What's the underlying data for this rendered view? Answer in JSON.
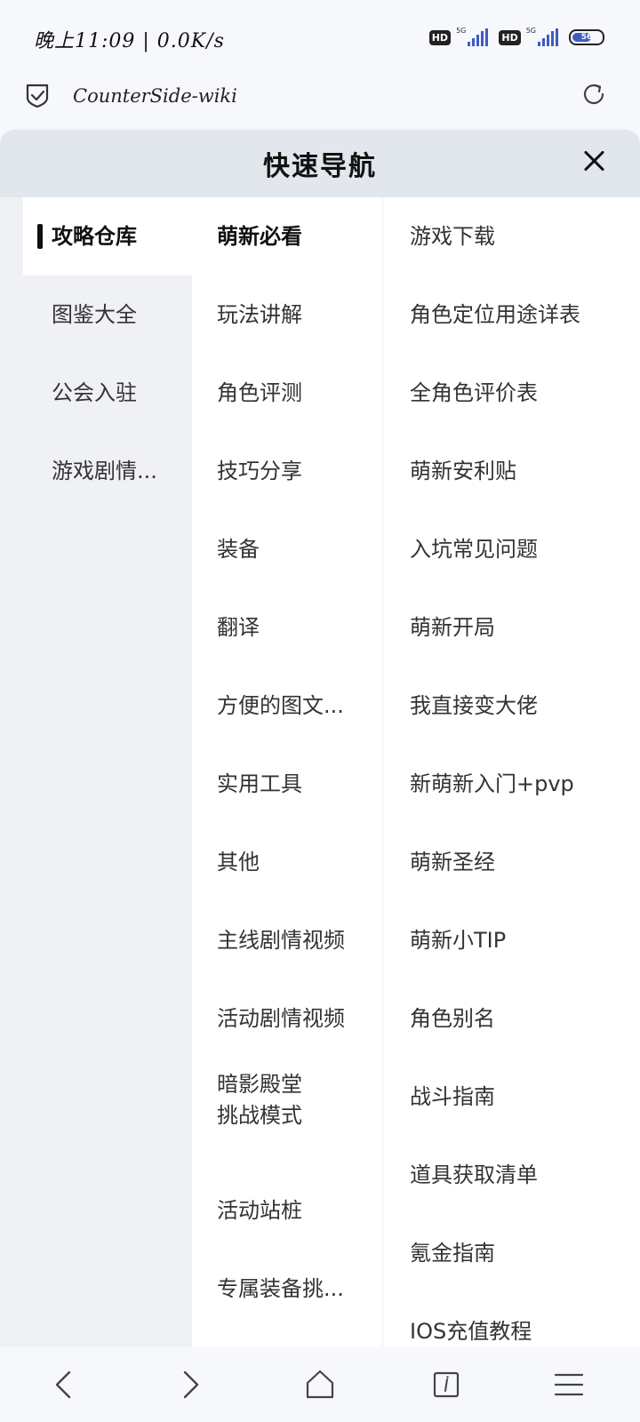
{
  "status_bar": {
    "time": "晚上11:09 | 0.0K/s",
    "hd1": "HD",
    "hd2": "HD",
    "net1": "5G",
    "net2": "5G",
    "battery": "56"
  },
  "address_bar": {
    "title": "CounterSide-wiki"
  },
  "drawer": {
    "title": "快速导航",
    "categories": [
      "攻略仓库",
      "图鉴大全",
      "公会入驻",
      "游戏剧情..."
    ],
    "subcategories": [
      "萌新必看",
      "玩法讲解",
      "角色评测",
      "技巧分享",
      "装备",
      "翻译",
      "方便的图文...",
      "实用工具",
      "其他",
      "主线剧情视频",
      "活动剧情视频",
      "暗影殿堂",
      "挑战模式",
      "活动站桩",
      "专属装备挑..."
    ],
    "links": [
      "游戏下载",
      "角色定位用途详表",
      "全角色评价表",
      "萌新安利贴",
      "入坑常见问题",
      "萌新开局",
      "我直接变大佬",
      "新萌新入门+pvp",
      "萌新圣经",
      "萌新小TIP",
      "角色别名",
      "战斗指南",
      "道具获取清单",
      "氪金指南",
      "IOS充值教程"
    ]
  },
  "colors": {
    "accent": "#3f5cc2",
    "header_bg": "#e2e7ed",
    "sidebar_bg": "#eff1f4"
  }
}
